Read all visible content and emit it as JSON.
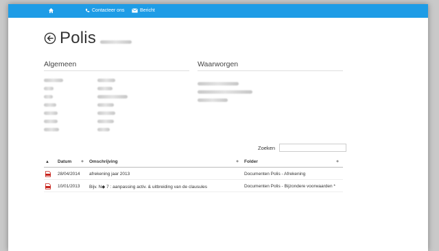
{
  "nav": {
    "contact_label": "Contacteer ons",
    "message_label": "Bericht",
    "bar_color": "#1e9ce6"
  },
  "title": "Polis",
  "sections": {
    "algemeen": "Algemeen",
    "waarborgen": "Waarworgen"
  },
  "search": {
    "label": "Zoeken",
    "value": ""
  },
  "table": {
    "columns": [
      "Datum",
      "Omschrijving",
      "Folder"
    ],
    "rows": [
      {
        "icon": "pdf-icon",
        "datum": "28/04/2014",
        "omschrijving": "afrekening jaar 2013",
        "folder": "Documenten Polis - Afrekening"
      },
      {
        "icon": "pdf-icon",
        "datum": "10/01/2013",
        "omschrijving": "Bijv. N◆ 7 : aanpassing activ. & uitbreiding van de clausules",
        "folder": "Documenten Polis - Bijzondere voorwaarden *"
      }
    ]
  }
}
